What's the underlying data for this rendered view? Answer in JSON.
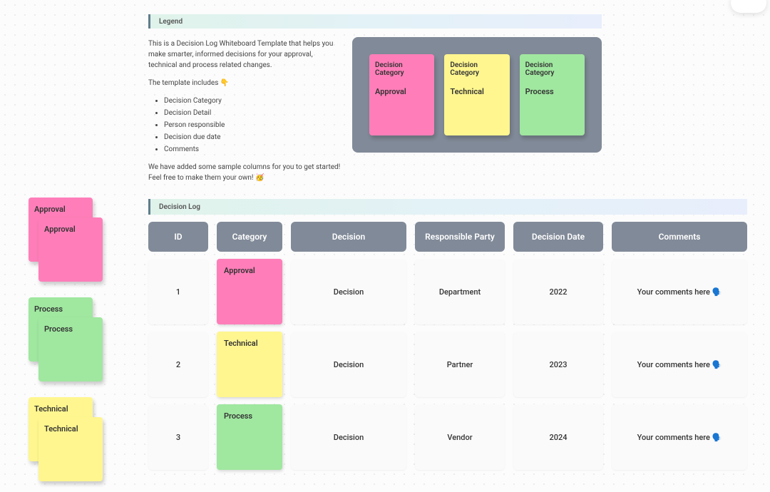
{
  "legend": {
    "title": "Legend",
    "intro": "This is a Decision Log Whiteboard Template that helps you make smarter, informed decisions for your approval, technical and process related changes.",
    "includes_line": "The template includes 👇",
    "bullets": [
      "Decision Category",
      "Decision Detail",
      "Person responsible",
      "Decision due date",
      "Comments"
    ],
    "outro": "We have added some sample columns for you to get started! Feel free to make them your own! 🥳",
    "cards": [
      {
        "heading": "Decision Category",
        "value": "Approval"
      },
      {
        "heading": "Decision Category",
        "value": "Technical"
      },
      {
        "heading": "Decision Category",
        "value": "Process"
      }
    ]
  },
  "side": {
    "approval": "Approval",
    "process": "Process",
    "technical": "Technical"
  },
  "log": {
    "title": "Decision Log",
    "columns": [
      "ID",
      "Category",
      "Decision",
      "Responsible Party",
      "Decision Date",
      "Comments"
    ],
    "rows": [
      {
        "id": "1",
        "category": "Approval",
        "decision": "Decision",
        "responsible": "Department",
        "date": "2022",
        "comments": "Your comments here 🗣️"
      },
      {
        "id": "2",
        "category": "Technical",
        "decision": "Decision",
        "responsible": "Partner",
        "date": "2023",
        "comments": "Your comments here 🗣️"
      },
      {
        "id": "3",
        "category": "Process",
        "decision": "Decision",
        "responsible": "Vendor",
        "date": "2024",
        "comments": "Your comments here 🗣️"
      }
    ]
  }
}
